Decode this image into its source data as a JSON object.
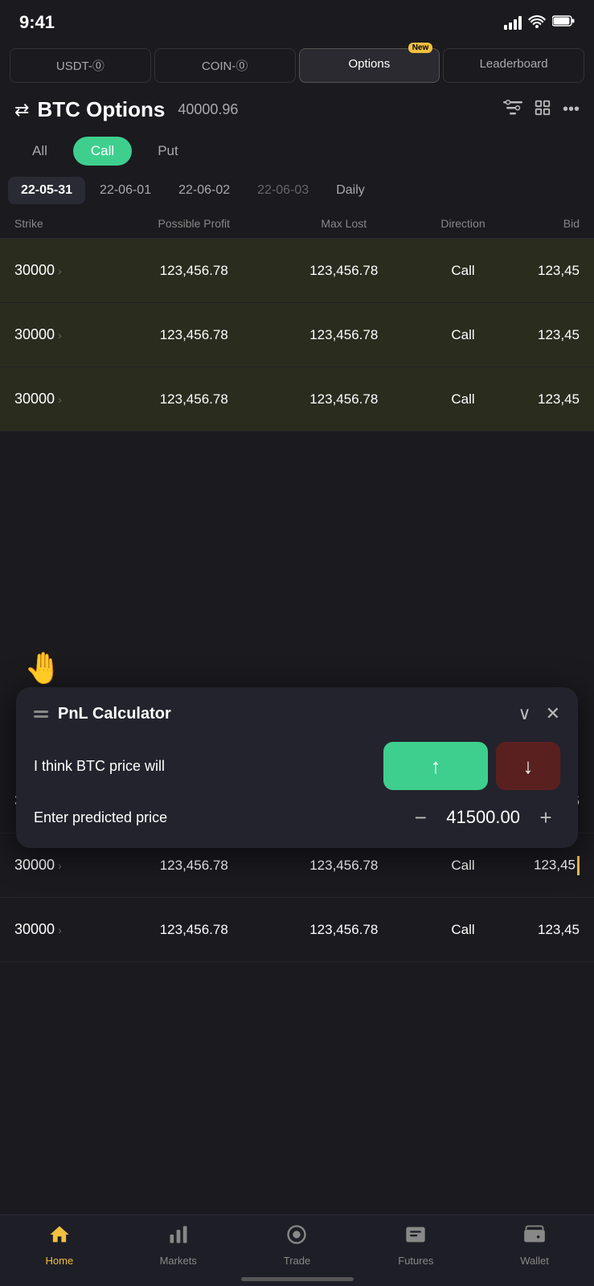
{
  "statusBar": {
    "time": "9:41"
  },
  "tabs": [
    {
      "id": "usdt",
      "label": "USDT-⓪",
      "active": false
    },
    {
      "id": "coin",
      "label": "COIN-⓪",
      "active": false
    },
    {
      "id": "options",
      "label": "Options",
      "active": true,
      "badge": "New"
    },
    {
      "id": "leaderboard",
      "label": "Leaderboard",
      "active": false
    }
  ],
  "header": {
    "title": "BTC Options",
    "price": "40000.96"
  },
  "filterTabs": [
    "All",
    "Call",
    "Put"
  ],
  "activeFilter": "Call",
  "dateTabs": [
    "22-05-31",
    "22-06-01",
    "22-06-02",
    "22-06-03",
    "Daily"
  ],
  "activeDate": "22-05-31",
  "tableHeaders": {
    "strike": "Strike",
    "possibleProfit": "Possible Profit",
    "maxLost": "Max Lost",
    "direction": "Direction",
    "bid": "Bid"
  },
  "tableRows": [
    {
      "strike": "30000",
      "possibleProfit": "123,456.78",
      "maxLost": "123,456.78",
      "direction": "Call",
      "bid": "123,45",
      "highlighted": true
    },
    {
      "strike": "30000",
      "possibleProfit": "123,456.78",
      "maxLost": "123,456.78",
      "direction": "Call",
      "bid": "123,45",
      "highlighted": true
    },
    {
      "strike": "30000",
      "possibleProfit": "123,456.78",
      "maxLost": "123,456.78",
      "direction": "Call",
      "bid": "123,45",
      "highlighted": true
    },
    {
      "strike": "30000",
      "possibleProfit": "123,456.78",
      "maxLost": "123,456.78",
      "direction": "Call",
      "bid": "123,45",
      "highlighted": false
    },
    {
      "strike": "30000",
      "possibleProfit": "123,456.78",
      "maxLost": "123,456.78",
      "direction": "Call",
      "bid": "123,45",
      "highlighted": false
    },
    {
      "strike": "30000",
      "possibleProfit": "123,456.78",
      "maxLost": "123,456.78",
      "direction": "Call",
      "bid": "123,45",
      "highlighted": false
    }
  ],
  "pnlCalculator": {
    "title": "PnL Calculator",
    "prompt": "I think BTC price will",
    "predictedPriceLabel": "Enter predicted price",
    "predictedPriceValue": "41500.00",
    "upButtonLabel": "↑",
    "downButtonLabel": "↓",
    "minusLabel": "−",
    "plusLabel": "+"
  },
  "bottomNav": [
    {
      "id": "home",
      "label": "Home",
      "active": true,
      "icon": "🏠"
    },
    {
      "id": "markets",
      "label": "Markets",
      "active": false,
      "icon": "📊"
    },
    {
      "id": "trade",
      "label": "Trade",
      "active": false,
      "icon": "🔘"
    },
    {
      "id": "futures",
      "label": "Futures",
      "active": false,
      "icon": "🖥"
    },
    {
      "id": "wallet",
      "label": "Wallet",
      "active": false,
      "icon": "👛"
    }
  ]
}
